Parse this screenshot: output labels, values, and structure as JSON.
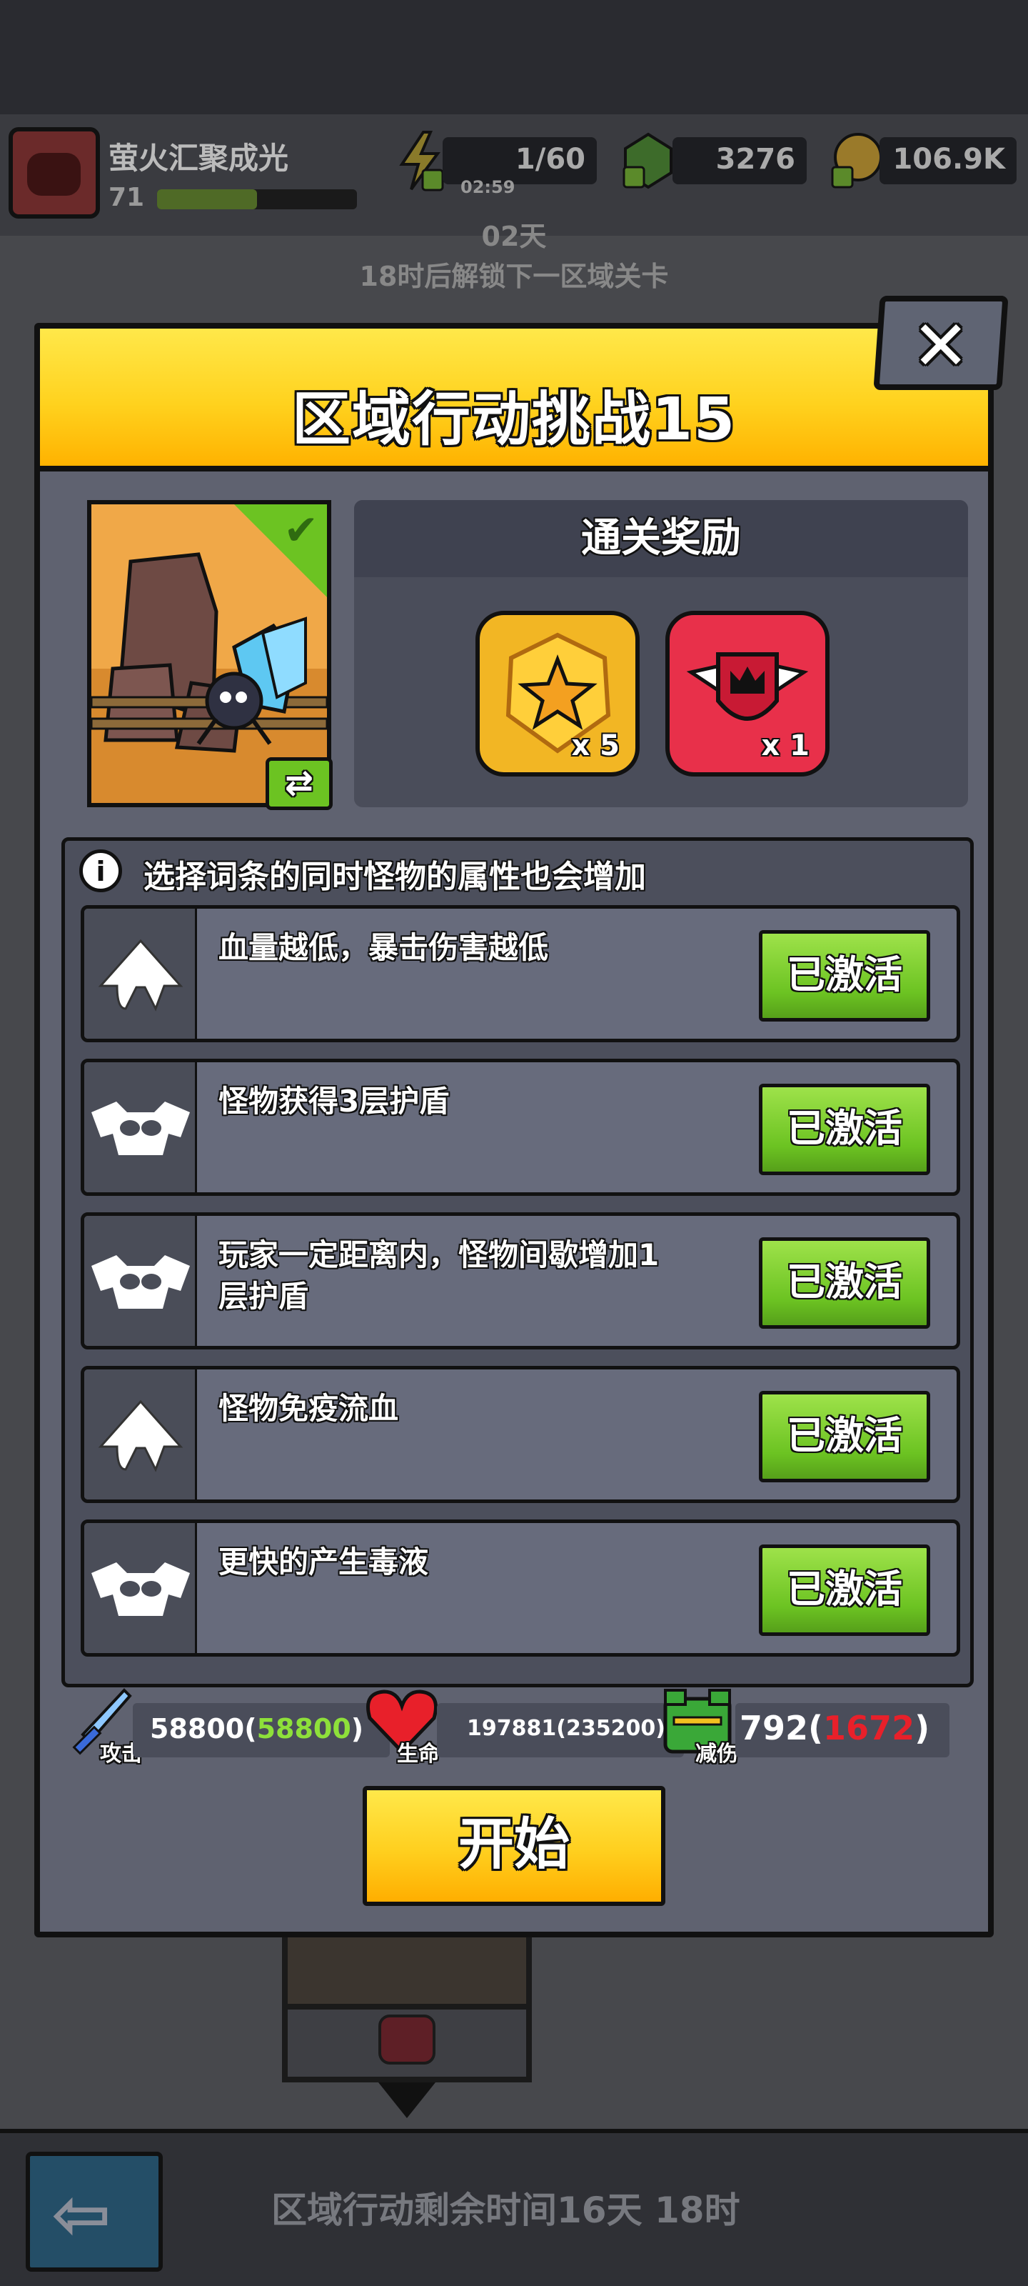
{
  "topbar": {
    "player_name": "萤火汇聚成光",
    "player_level": "71",
    "xp_fraction": 0.5,
    "energy": "1/60",
    "energy_timer": "02:59",
    "gems": "3276",
    "gold": "106.9K"
  },
  "unlock": {
    "days": "02天",
    "text": "18时后解锁下一区域关卡"
  },
  "modal": {
    "title": "区域行动挑战15",
    "close_label": "✕",
    "level_image_icon": "desert-crystal-spider",
    "swap_label": "⇄",
    "reward_header": "通关奖励",
    "rewards": [
      {
        "icon": "star-badge",
        "count": "x 5",
        "color": "#f2b624"
      },
      {
        "icon": "winged-crown-badge",
        "count": "x 1",
        "color": "#e8304a"
      }
    ],
    "affix_desc": "选择词条的同时怪物的属性也会增加",
    "affixes": [
      {
        "icon": "up-arrow-icon",
        "text": "血量越低，暴击伤害越低",
        "button": "已激活"
      },
      {
        "icon": "bat-skull-icon",
        "text": "怪物获得3层护盾",
        "button": "已激活"
      },
      {
        "icon": "bat-skull-icon",
        "text": "玩家一定距离内，怪物间歇增加1层护盾",
        "button": "已激活"
      },
      {
        "icon": "up-arrow-icon",
        "text": "怪物免疫流血",
        "button": "已激活"
      },
      {
        "icon": "bat-skull-icon",
        "text": "更快的产生毒液",
        "button": "已激活"
      }
    ],
    "stats": {
      "attack_label": "攻击",
      "attack_base": "58800(",
      "attack_bonus": "58800",
      "attack_close": ")",
      "life_label": "生命",
      "life_value": "197881(235200)",
      "reduce_label": "减伤",
      "reduce_base": "792(",
      "reduce_bonus": "1672",
      "reduce_close": ")"
    },
    "start_label": "开始"
  },
  "bottom": {
    "remaining": "区域行动剩余时间16天 18时"
  },
  "colors": {
    "accent_yellow": "#ffd21e",
    "activated_green": "#6cc322",
    "bonus_green": "#8ee03a",
    "bonus_red": "#e8202a"
  }
}
